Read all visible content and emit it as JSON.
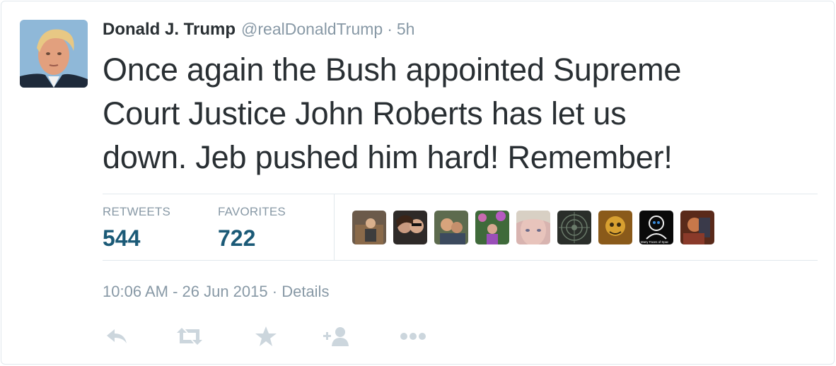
{
  "tweet": {
    "author_name": "Donald J. Trump",
    "handle": "@realDonaldTrump",
    "separator": "·",
    "relative_time": "5h",
    "text_lines": [
      "Once again the Bush appointed  Supreme",
      "Court Justice John Roberts has let us",
      "down. Jeb pushed him hard! Remember!"
    ]
  },
  "stats": {
    "retweets_label": "RETWEETS",
    "retweets_count": "544",
    "favorites_label": "FAVORITES",
    "favorites_count": "722"
  },
  "favoriter_overlay_text": "Many Faces of Spac",
  "meta": {
    "timestamp": "10:06 AM - 26 Jun 2015",
    "separator": "·",
    "details_label": "Details"
  },
  "actions": [
    {
      "name": "reply",
      "icon": "reply-icon"
    },
    {
      "name": "retweet",
      "icon": "retweet-icon"
    },
    {
      "name": "favorite",
      "icon": "star-icon"
    },
    {
      "name": "follow",
      "icon": "follow-icon"
    },
    {
      "name": "more",
      "icon": "more-icon"
    }
  ],
  "colors": {
    "text": "#292f33",
    "muted": "#8899a6",
    "stat_count": "#1b5a77",
    "divider": "#e1e8ed",
    "action_icon": "#ccd6dd"
  }
}
